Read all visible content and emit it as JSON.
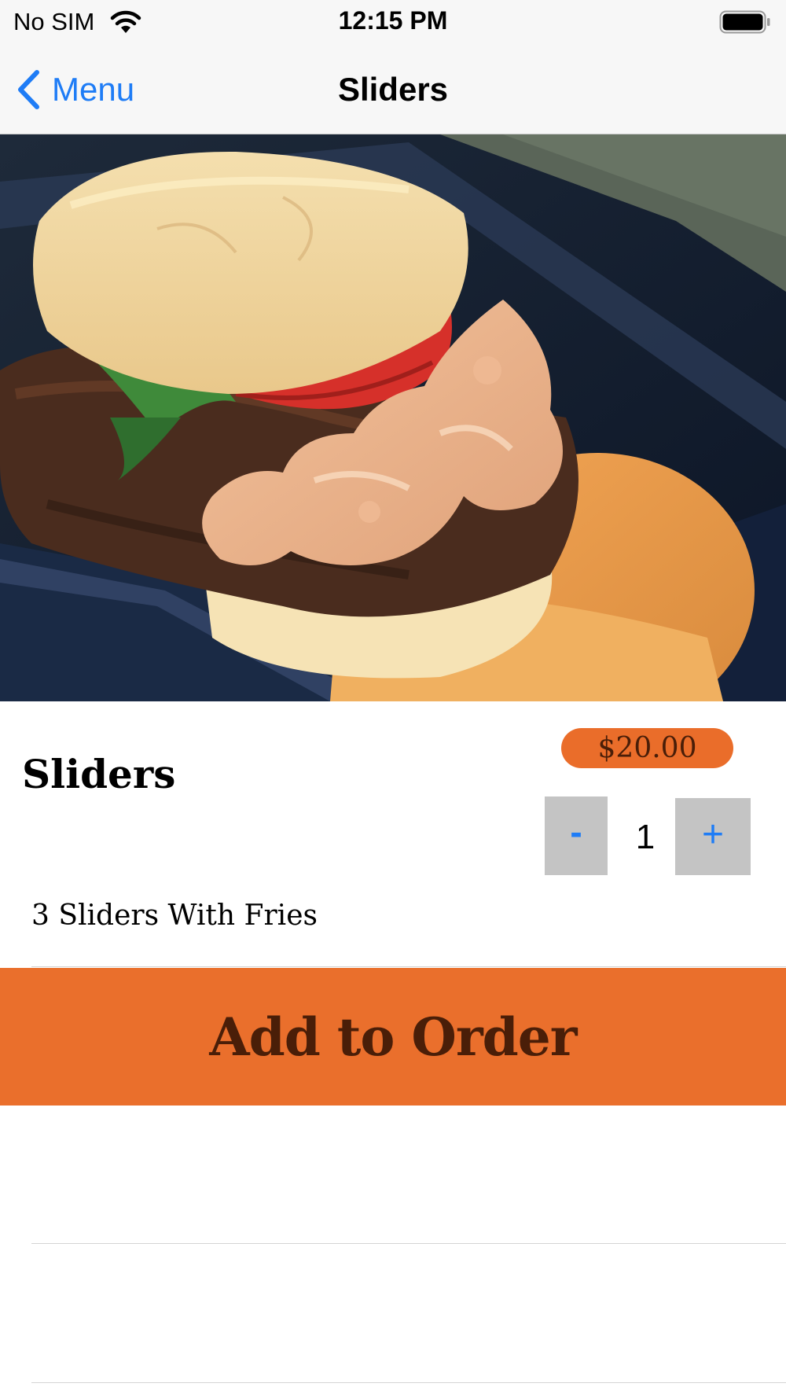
{
  "status_bar": {
    "carrier": "No SIM",
    "time": "12:15 PM",
    "icons": [
      "wifi-icon",
      "battery-icon"
    ]
  },
  "nav_bar": {
    "back_label": "Menu",
    "title": "Sliders",
    "back_icon": "chevron-left-icon"
  },
  "hero_image": {
    "subject": "food-photo"
  },
  "item": {
    "name": "Sliders",
    "price": "$20.00",
    "description": "3 Sliders With Fries"
  },
  "stepper": {
    "minus_label": "-",
    "quantity": "1",
    "plus_label": "+"
  },
  "add_button": {
    "label": "Add to Order"
  },
  "colors": {
    "accent_orange": "#ea6f2c",
    "accent_text": "#4a1e08",
    "ios_blue": "#1e7cf6",
    "stepper_gray": "#c4c4c4"
  }
}
